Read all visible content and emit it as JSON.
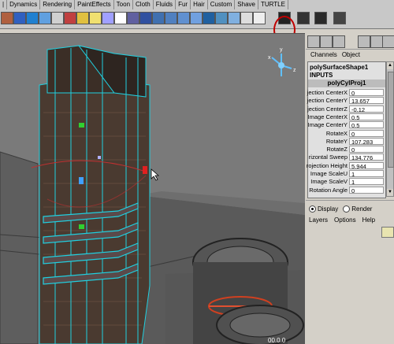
{
  "shelf": {
    "tabs": [
      "|",
      "Dynamics",
      "Rendering",
      "PaintEffects",
      "Toon",
      "Cloth",
      "Fluids",
      "Fur",
      "Hair",
      "Custom",
      "Shave",
      "TURTLE"
    ],
    "highlight_color": "#c00000"
  },
  "channel_box": {
    "tabs": [
      "Channels",
      "Object"
    ],
    "shape_name": "polySurfaceShape1",
    "inputs_label": "INPUTS",
    "node_name": "polyCylProj1",
    "attributes": [
      {
        "label": "jection CenterX",
        "value": "0"
      },
      {
        "label": "jection CenterY",
        "value": "13.657"
      },
      {
        "label": "jection CenterZ",
        "value": "-0.12"
      },
      {
        "label": "Image CenterX",
        "value": "0.5"
      },
      {
        "label": "Image CenterY",
        "value": "0.5"
      },
      {
        "label": "RotateX",
        "value": "0"
      },
      {
        "label": "RotateY",
        "value": "107.283"
      },
      {
        "label": "RotateZ",
        "value": "0"
      },
      {
        "label": "rizontal Sweep",
        "value": "134.776"
      },
      {
        "label": "rojection Height",
        "value": "5.944"
      },
      {
        "label": "Image ScaleU",
        "value": "1"
      },
      {
        "label": "Image ScaleV",
        "value": "1"
      },
      {
        "label": "Rotation Angle",
        "value": "0"
      }
    ]
  },
  "layer_editor": {
    "modes": [
      "Display",
      "Render"
    ],
    "selected_mode": "Display",
    "menu": [
      "Layers",
      "Options",
      "Help"
    ]
  },
  "viewport": {
    "axis_labels": [
      "x",
      "y",
      "z"
    ],
    "bottom_readout": "00.0.0"
  }
}
